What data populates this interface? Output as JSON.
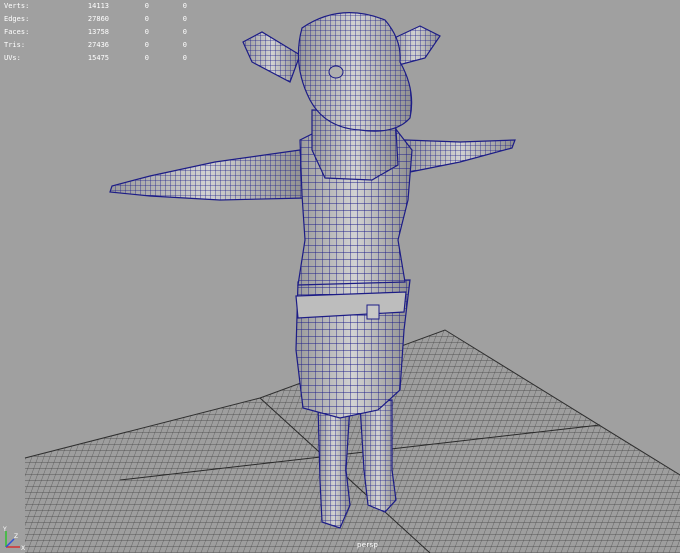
{
  "hud": {
    "rows": [
      {
        "label": "Verts:",
        "values": [
          "14113",
          "0",
          "0"
        ]
      },
      {
        "label": "Edges:",
        "values": [
          "27860",
          "0",
          "0"
        ]
      },
      {
        "label": "Faces:",
        "values": [
          "13758",
          "0",
          "0"
        ]
      },
      {
        "label": "Tris:",
        "values": [
          "27436",
          "0",
          "0"
        ]
      },
      {
        "label": "UVs:",
        "values": [
          "15475",
          "0",
          "0"
        ]
      }
    ]
  },
  "viewport": {
    "camera": "persp",
    "background": "#a0a0a0",
    "wire_color": "#1c1c86",
    "shade_color": "#c6c6c6",
    "grid_color": "#3a3a3a"
  },
  "axis": {
    "x": "X",
    "y": "Y",
    "z": "Z"
  }
}
